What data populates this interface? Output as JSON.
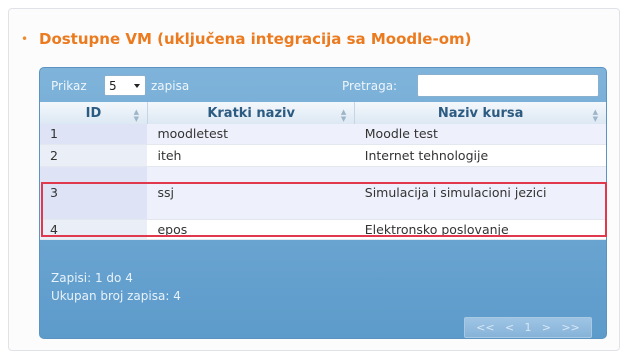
{
  "panel": {
    "title": "Dostupne VM (uključena integracija sa Moodle-om)"
  },
  "toolbar": {
    "show_label": "Prikaz",
    "page_size": "5",
    "records_label": "zapisa",
    "search_label": "Pretraga:",
    "search_value": ""
  },
  "table": {
    "headers": [
      "ID",
      "Kratki naziv",
      "Naziv kursa"
    ],
    "rows": [
      [
        "1",
        "moodletest",
        "Moodle test"
      ],
      [
        "2",
        "iteh",
        "Internet tehnologije"
      ],
      [
        "3",
        "ssj",
        "Simulacija i simulacioni jezici"
      ],
      [
        "4",
        "epos",
        "Elektronsko poslovanje"
      ]
    ]
  },
  "footer": {
    "records_info": "Zapisi: 1 do 4",
    "total_info": "Ukupan broj zapisa: 4"
  },
  "pagination": {
    "first": "<<",
    "prev": "<",
    "current": "1",
    "next": ">",
    "last": ">>"
  },
  "colors": {
    "title": "#ec7a1e",
    "table_header_bg": "#6ea8d4",
    "highlight_border": "#e0384c"
  }
}
